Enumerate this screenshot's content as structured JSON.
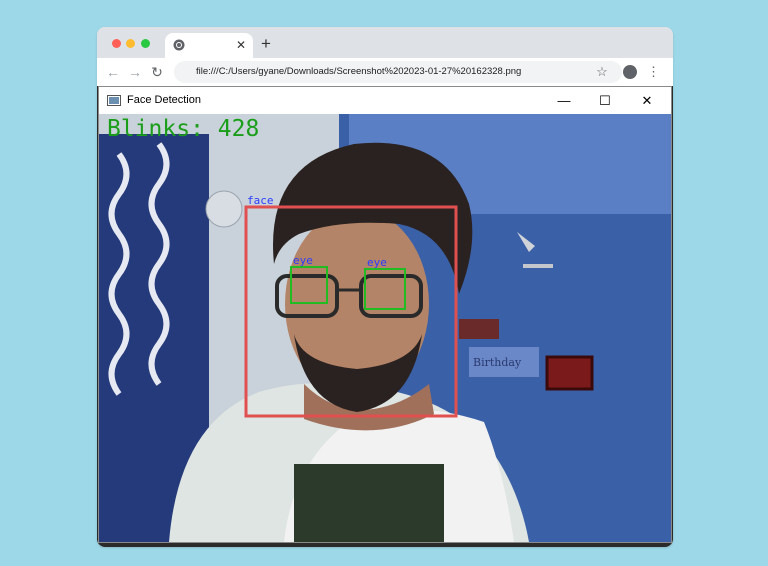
{
  "browser": {
    "tab": {
      "favicon_icon": "chrome-icon",
      "close_label": "✕"
    },
    "new_tab_label": "+",
    "nav": {
      "back_label": "←",
      "forward_label": "→",
      "reload_label": "↻"
    },
    "url": "file:///C:/Users/gyane/Downloads/Screenshot%202023-01-27%20162328.png",
    "bookmark_label": "☆",
    "menu_label": "⋮"
  },
  "window": {
    "title": "Face Detection",
    "minimize_label": "—",
    "maximize_label": "☐",
    "close_label": "✕"
  },
  "overlay": {
    "blinks_text": "Blinks: 428",
    "face_label": "face",
    "eye_left_label": "eye",
    "eye_right_label": "eye",
    "colors": {
      "blink_text": "#1a9e1a",
      "face_box": "#e05050",
      "eye_box": "#22bb22",
      "label_text": "#2a3cff"
    }
  },
  "scene": {
    "poster_text": "Birthday"
  }
}
